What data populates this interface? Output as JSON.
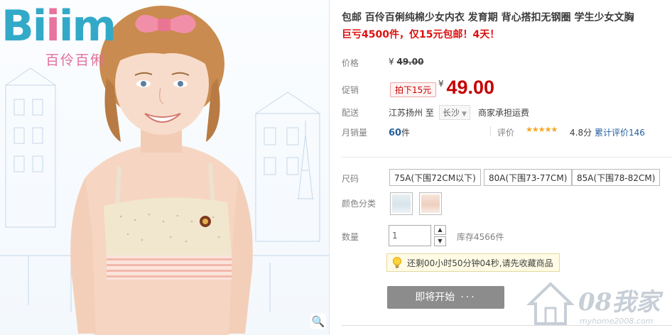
{
  "brand": {
    "logo_part1": "Bi",
    "logo_part2": "im",
    "logo_accent": "i",
    "logo_sub": "百伶百俐",
    "colors": {
      "blue": "#33a9c8",
      "pink": "#e8749e"
    }
  },
  "image": {
    "zoom_icon": "magnifier-icon"
  },
  "product": {
    "title": "包邮 百伶百俐纯棉少女内衣 发育期 背心搭扣无钢圈 学生少女文胸",
    "subtitle": "巨亏4500件，仅15元包邮！4天！"
  },
  "price": {
    "label": "价格",
    "yen": "¥",
    "original": "49.00"
  },
  "promo": {
    "label": "促销",
    "badge": "拍下15元",
    "yen": "¥",
    "price": "49.00",
    "color": "#c40000"
  },
  "shipping": {
    "label": "配送",
    "from": "江苏扬州 至",
    "to": "长沙",
    "fee": "商家承担运费"
  },
  "sales": {
    "label": "月销量",
    "count": "60",
    "unit": "件",
    "rating_label": "评价",
    "stars": "★★★★★",
    "score": "4.8分",
    "review_link": "累计评价146"
  },
  "sizes": {
    "label": "尺码",
    "options": [
      "75A(下围72CM以下)",
      "80A(下围73-77CM)",
      "85A(下围78-82CM)"
    ]
  },
  "colors": {
    "label": "颜色分类",
    "swatches": [
      "#dfe9ee",
      "#f1d9cf"
    ]
  },
  "quantity": {
    "label": "数量",
    "value": "1",
    "stock": "库存4566件"
  },
  "countdown": {
    "icon": "lightbulb-icon",
    "text": "还剩00小时50分钟04秒,请先收藏商品"
  },
  "buy": {
    "label": "即将开始",
    "dots": "···"
  },
  "watermark": {
    "text": "08我家",
    "url": "myhome2008.com"
  }
}
